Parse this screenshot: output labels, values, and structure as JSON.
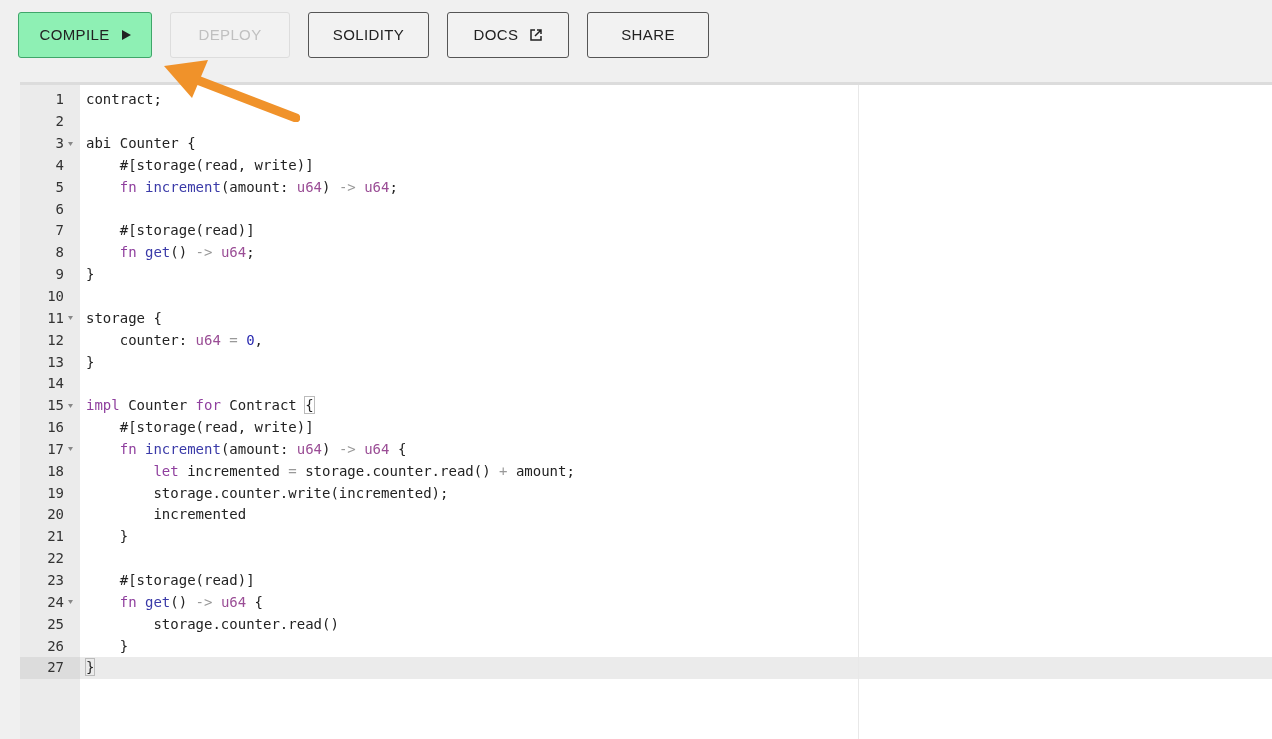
{
  "toolbar": {
    "buttons": [
      {
        "label": "COMPILE",
        "kind": "run",
        "disabled": false
      },
      {
        "label": "DEPLOY",
        "kind": "plain",
        "disabled": true
      },
      {
        "label": "SOLIDITY",
        "kind": "plain",
        "disabled": false
      },
      {
        "label": "DOCS",
        "kind": "external",
        "disabled": false
      },
      {
        "label": "SHARE",
        "kind": "plain",
        "disabled": false
      }
    ]
  },
  "editor": {
    "lines": [
      {
        "number": "1",
        "foldable": false,
        "active": false,
        "tokens": [
          {
            "text": "contract;",
            "kind": "plain"
          }
        ]
      },
      {
        "number": "2",
        "foldable": false,
        "active": false
      },
      {
        "number": "3",
        "foldable": true,
        "active": false,
        "tokens": [
          {
            "text": "abi Counter {",
            "kind": "plain"
          }
        ]
      },
      {
        "number": "4",
        "foldable": false,
        "active": false,
        "tokens": [
          {
            "text": "    #[storage(read, write)]",
            "kind": "plain"
          }
        ]
      },
      {
        "number": "5",
        "foldable": false,
        "active": false,
        "tokens": [
          {
            "text": "    fn",
            "kind": "keyword"
          },
          {
            "text": " increment",
            "kind": "function"
          },
          {
            "text": "(amount: ",
            "kind": "plain"
          },
          {
            "text": "u64",
            "kind": "type"
          },
          {
            "text": ") ",
            "kind": "plain"
          },
          {
            "text": "->",
            "kind": "operator"
          },
          {
            "text": " u64",
            "kind": "type"
          },
          {
            "text": ";",
            "kind": "plain"
          }
        ]
      },
      {
        "number": "6",
        "foldable": false,
        "active": false
      },
      {
        "number": "7",
        "foldable": false,
        "active": false,
        "tokens": [
          {
            "text": "    #[storage(read)]",
            "kind": "plain"
          }
        ]
      },
      {
        "number": "8",
        "foldable": false,
        "active": false,
        "tokens": [
          {
            "text": "    fn",
            "kind": "keyword"
          },
          {
            "text": " get",
            "kind": "function"
          },
          {
            "text": "() ",
            "kind": "plain"
          },
          {
            "text": "->",
            "kind": "operator"
          },
          {
            "text": " u64",
            "kind": "type"
          },
          {
            "text": ";",
            "kind": "plain"
          }
        ]
      },
      {
        "number": "9",
        "foldable": false,
        "active": false,
        "tokens": [
          {
            "text": "}",
            "kind": "plain"
          }
        ]
      },
      {
        "number": "10",
        "foldable": false,
        "active": false
      },
      {
        "number": "11",
        "foldable": true,
        "active": false,
        "tokens": [
          {
            "text": "storage {",
            "kind": "plain"
          }
        ]
      },
      {
        "number": "12",
        "foldable": false,
        "active": false,
        "tokens": [
          {
            "text": "    counter: ",
            "kind": "plain"
          },
          {
            "text": "u64",
            "kind": "type"
          },
          {
            "text": " =",
            "kind": "operator"
          },
          {
            "text": " 0",
            "kind": "number"
          },
          {
            "text": ",",
            "kind": "plain"
          }
        ]
      },
      {
        "number": "13",
        "foldable": false,
        "active": false,
        "tokens": [
          {
            "text": "}",
            "kind": "plain"
          }
        ]
      },
      {
        "number": "14",
        "foldable": false,
        "active": false
      },
      {
        "number": "15",
        "foldable": true,
        "active": false,
        "tokens": [
          {
            "text": "impl",
            "kind": "keyword"
          },
          {
            "text": " Counter ",
            "kind": "plain"
          },
          {
            "text": "for",
            "kind": "keyword"
          },
          {
            "text": " Contract ",
            "kind": "plain"
          },
          {
            "text": "{",
            "kind": "bracket-match"
          }
        ]
      },
      {
        "number": "16",
        "foldable": false,
        "active": false,
        "tokens": [
          {
            "text": "    #[storage(read, write)]",
            "kind": "plain"
          }
        ]
      },
      {
        "number": "17",
        "foldable": true,
        "active": false,
        "tokens": [
          {
            "text": "    fn",
            "kind": "keyword"
          },
          {
            "text": " increment",
            "kind": "function"
          },
          {
            "text": "(amount: ",
            "kind": "plain"
          },
          {
            "text": "u64",
            "kind": "type"
          },
          {
            "text": ") ",
            "kind": "plain"
          },
          {
            "text": "->",
            "kind": "operator"
          },
          {
            "text": " u64",
            "kind": "type"
          },
          {
            "text": " {",
            "kind": "plain"
          }
        ]
      },
      {
        "number": "18",
        "foldable": false,
        "active": false,
        "tokens": [
          {
            "text": "        let",
            "kind": "keyword"
          },
          {
            "text": " incremented ",
            "kind": "plain"
          },
          {
            "text": "=",
            "kind": "operator"
          },
          {
            "text": " storage.counter.read() ",
            "kind": "plain"
          },
          {
            "text": "+",
            "kind": "operator"
          },
          {
            "text": " amount;",
            "kind": "plain"
          }
        ]
      },
      {
        "number": "19",
        "foldable": false,
        "active": false,
        "tokens": [
          {
            "text": "        storage.counter.write(incremented);",
            "kind": "plain"
          }
        ]
      },
      {
        "number": "20",
        "foldable": false,
        "active": false,
        "tokens": [
          {
            "text": "        incremented",
            "kind": "plain"
          }
        ]
      },
      {
        "number": "21",
        "foldable": false,
        "active": false,
        "tokens": [
          {
            "text": "    }",
            "kind": "plain"
          }
        ]
      },
      {
        "number": "22",
        "foldable": false,
        "active": false
      },
      {
        "number": "23",
        "foldable": false,
        "active": false,
        "tokens": [
          {
            "text": "    #[storage(read)]",
            "kind": "plain"
          }
        ]
      },
      {
        "number": "24",
        "foldable": true,
        "active": false,
        "tokens": [
          {
            "text": "    fn",
            "kind": "keyword"
          },
          {
            "text": " get",
            "kind": "function"
          },
          {
            "text": "() ",
            "kind": "plain"
          },
          {
            "text": "->",
            "kind": "operator"
          },
          {
            "text": " u64",
            "kind": "type"
          },
          {
            "text": " {",
            "kind": "plain"
          }
        ]
      },
      {
        "number": "25",
        "foldable": false,
        "active": false,
        "tokens": [
          {
            "text": "        storage.counter.read()",
            "kind": "plain"
          }
        ]
      },
      {
        "number": "26",
        "foldable": false,
        "active": false,
        "tokens": [
          {
            "text": "    }",
            "kind": "plain"
          }
        ]
      },
      {
        "number": "27",
        "foldable": false,
        "active": true,
        "tokens": [
          {
            "text": "}",
            "kind": "bracket-match"
          }
        ]
      }
    ]
  }
}
